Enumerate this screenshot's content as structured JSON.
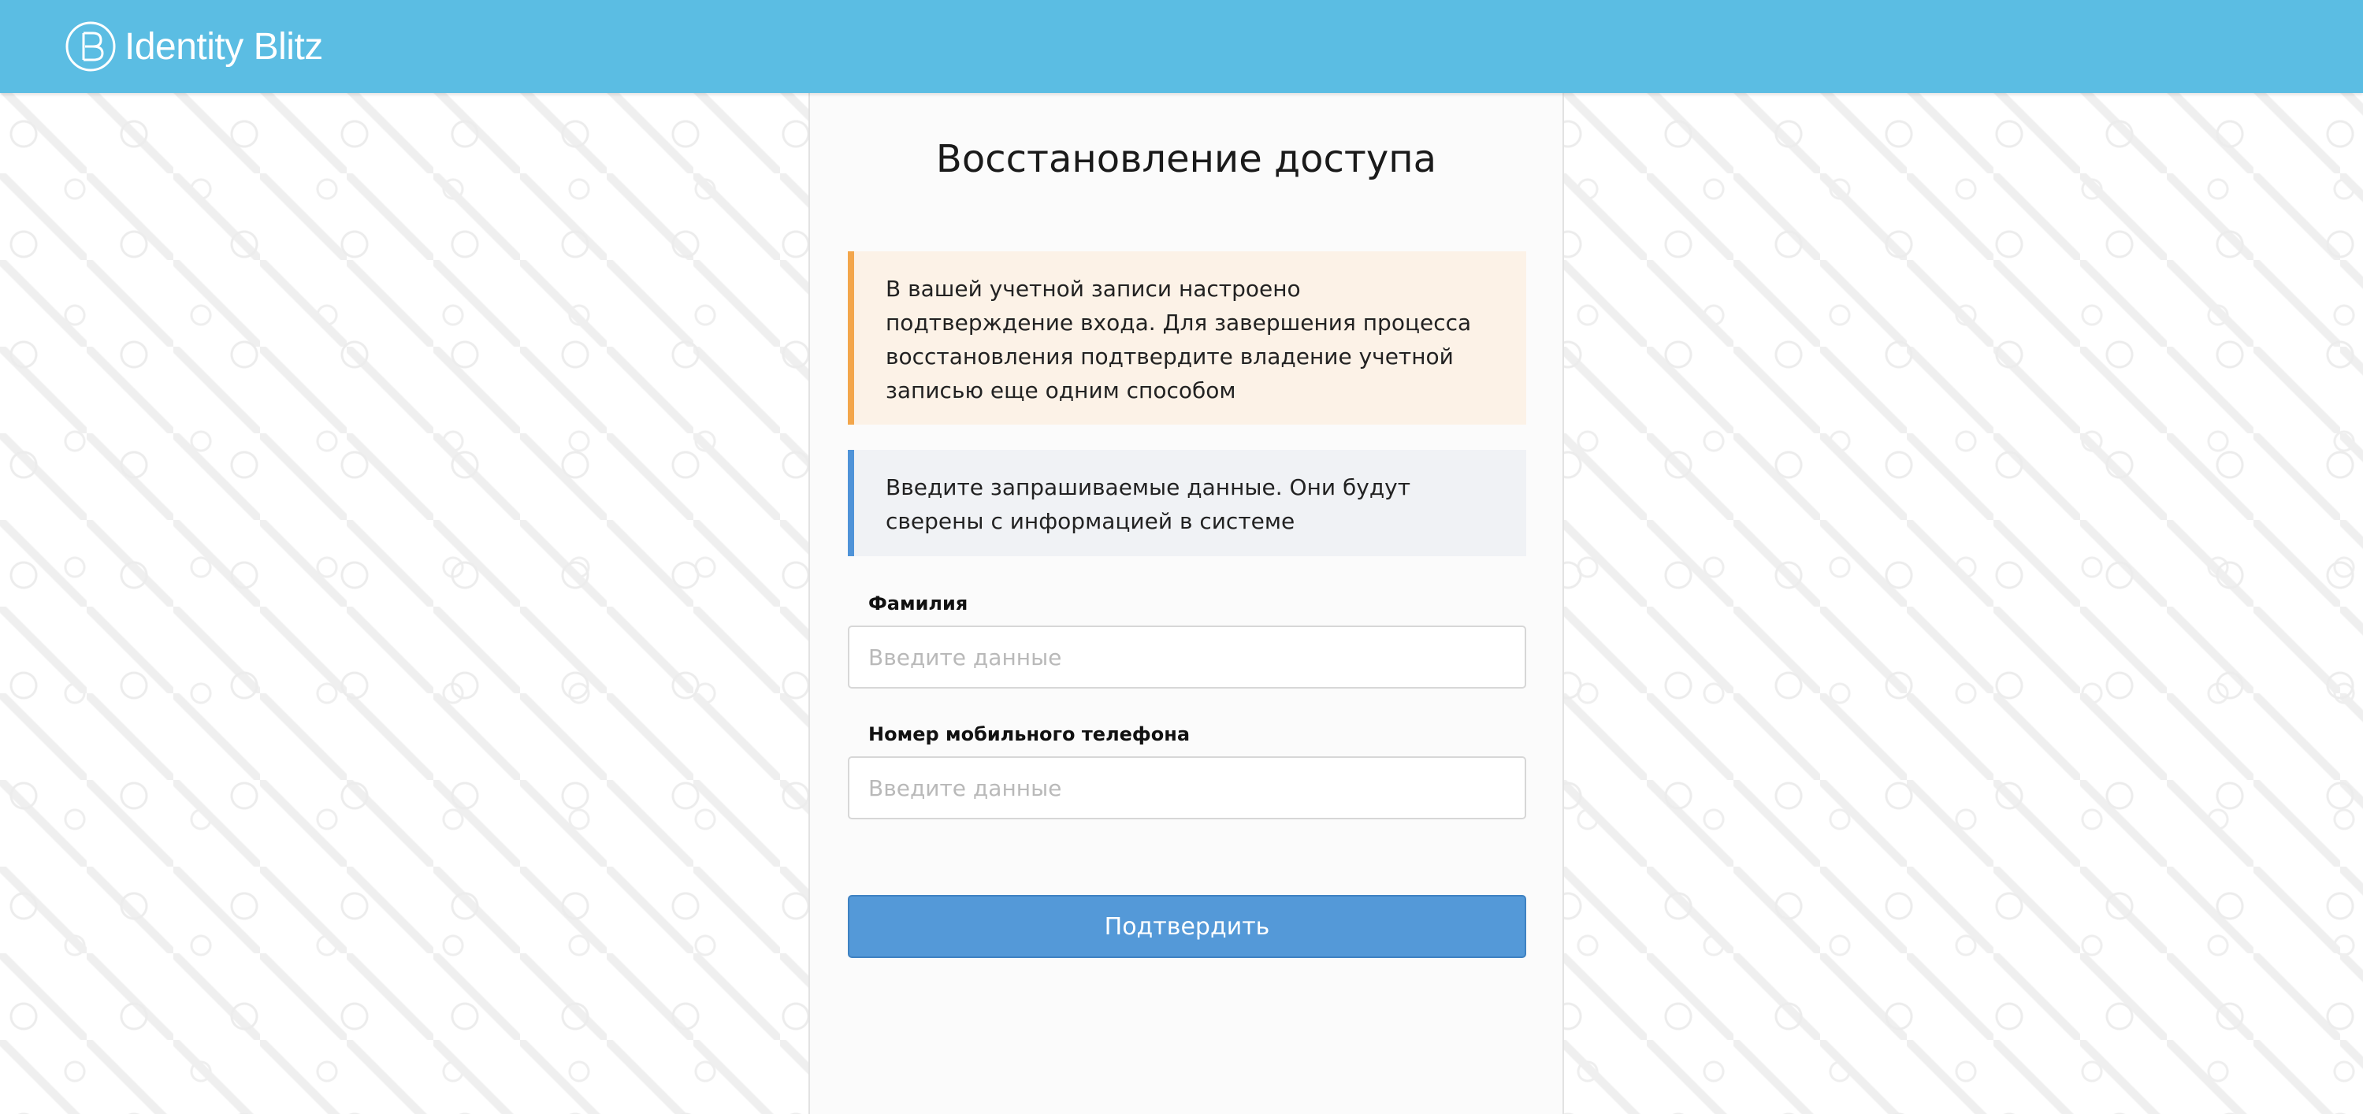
{
  "header": {
    "app_name": "Identity Blitz",
    "logo_icon": "blitz-logo-icon",
    "background_color": "#5bbde3"
  },
  "card": {
    "title": "Восстановление доступа",
    "alerts": [
      {
        "type": "warning",
        "accent_color": "#f3a64b",
        "text": "В вашей учетной записи настроено подтверждение входа. Для завершения процесса восстановления подтвердите владение учетной записью еще одним способом"
      },
      {
        "type": "info",
        "accent_color": "#4f93d8",
        "text": "Введите запрашиваемые данные. Они будут сверены с информацией в системе"
      }
    ],
    "fields": [
      {
        "label": "Фамилия",
        "placeholder": "Введите данные",
        "value": ""
      },
      {
        "label": "Номер мобильного телефона",
        "placeholder": "Введите данные",
        "value": ""
      }
    ],
    "submit_label": "Подтвердить",
    "submit_color": "#5499d8"
  }
}
